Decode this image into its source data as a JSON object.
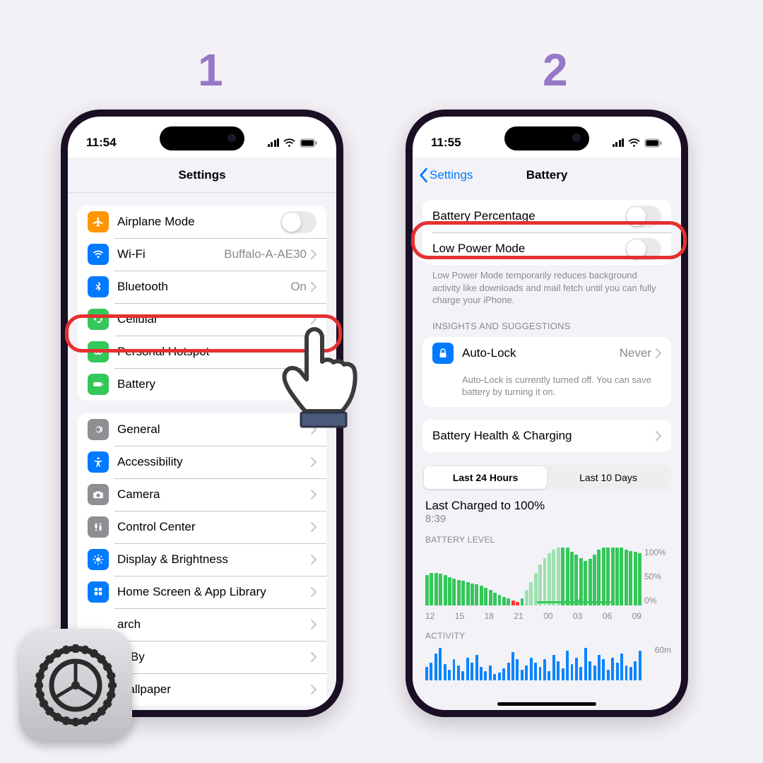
{
  "steps": {
    "one": "1",
    "two": "2"
  },
  "phone1": {
    "time": "11:54",
    "title": "Settings",
    "rows": {
      "airplane": "Airplane Mode",
      "wifi": "Wi-Fi",
      "wifi_value": "Buffalo-A-AE30",
      "bluetooth": "Bluetooth",
      "bluetooth_value": "On",
      "cellular": "Cellular",
      "hotspot": "Personal Hotspot",
      "battery": "Battery",
      "general": "General",
      "accessibility": "Accessibility",
      "camera": "Camera",
      "controlcenter": "Control Center",
      "display": "Display & Brightness",
      "homescreen": "Home Screen & App Library",
      "search": "arch",
      "standby": "ndBy",
      "wallpaper": "Wallpaper"
    }
  },
  "phone2": {
    "time": "11:55",
    "back": "Settings",
    "title": "Battery",
    "rows": {
      "percentage": "Battery Percentage",
      "lowpower": "Low Power Mode",
      "lowpower_note": "Low Power Mode temporarily reduces background activity like downloads and mail fetch until you can fully charge your iPhone.",
      "insights_header": "INSIGHTS AND SUGGESTIONS",
      "autolock": "Auto-Lock",
      "autolock_value": "Never",
      "autolock_note": "Auto-Lock is currently turned off. You can save battery by turning it on.",
      "health": "Battery Health & Charging"
    },
    "segmented": {
      "a": "Last 24 Hours",
      "b": "Last 10 Days"
    },
    "charge_title": "Last Charged to 100%",
    "charge_time": "8:39",
    "level_header": "BATTERY LEVEL",
    "activity_header": "ACTIVITY"
  },
  "chart_data": {
    "battery_level": {
      "type": "bar",
      "xlabel": "",
      "ylabel": "",
      "ylim": [
        0,
        100
      ],
      "ylabels": [
        "100%",
        "50%",
        "0%"
      ],
      "x_ticks": [
        "12",
        "15",
        "18",
        "21",
        "00",
        "03",
        "06",
        "09"
      ],
      "values": [
        52,
        56,
        56,
        54,
        52,
        48,
        46,
        44,
        42,
        40,
        38,
        36,
        34,
        30,
        26,
        22,
        18,
        14,
        12,
        8,
        6,
        12,
        26,
        40,
        56,
        70,
        82,
        90,
        96,
        100,
        100,
        100,
        92,
        88,
        82,
        76,
        80,
        88,
        96,
        100,
        100,
        100,
        100,
        100,
        96,
        94,
        92,
        90
      ],
      "low_indices": [
        19,
        20
      ],
      "light_indices": [
        22,
        23,
        24,
        25,
        26,
        27,
        28,
        29
      ],
      "y_label_right": "60m"
    },
    "activity": {
      "type": "bar",
      "values": [
        18,
        24,
        36,
        44,
        22,
        14,
        28,
        20,
        12,
        30,
        24,
        34,
        18,
        12,
        20,
        8,
        10,
        16,
        24,
        38,
        28,
        14,
        20,
        30,
        24,
        18,
        28,
        12,
        34,
        26,
        16,
        40,
        22,
        30,
        18,
        44,
        26,
        20,
        34,
        28,
        14,
        30,
        24,
        36,
        20,
        18,
        26,
        40
      ]
    }
  }
}
